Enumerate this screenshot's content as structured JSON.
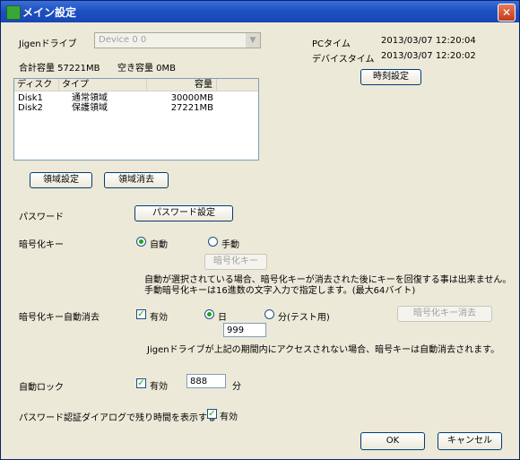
{
  "window": {
    "title": "メイン設定",
    "close": "✕"
  },
  "drive": {
    "label": "Jigenドライブ",
    "selected": "Device 0 0"
  },
  "capacity": {
    "total": "合計容量 57221MB",
    "free": "空き容量 0MB"
  },
  "clock": {
    "pc_label": "PCタイム",
    "pc_value": "2013/03/07 12:20:04",
    "device_label": "デバイスタイム",
    "device_value": "2013/03/07 12:20:02",
    "set_button": "時刻設定"
  },
  "disk_list": {
    "columns": [
      "ディスク",
      "タイプ",
      "容量"
    ],
    "rows": [
      [
        "Disk1",
        "通常領域",
        "30000MB"
      ],
      [
        "Disk2",
        "保護領域",
        "27221MB"
      ]
    ]
  },
  "area_buttons": {
    "setting": "領域設定",
    "erase": "領域消去"
  },
  "password": {
    "label": "パスワード",
    "button": "パスワード設定"
  },
  "enc_key": {
    "label": "暗号化キー",
    "auto": "自動",
    "manual": "手動",
    "button": "暗号化キー",
    "note1": "自動が選択されている場合、暗号化キーが消去された後にキーを回復する事は出来ません。",
    "note2": "手動暗号化キーは16進数の文字入力で指定します。(最大64バイト)"
  },
  "auto_erase": {
    "label": "暗号化キー自動消去",
    "enabled": "有効",
    "day": "日",
    "minute": "分(テスト用)",
    "erase_button": "暗号化キー消去",
    "value": "999",
    "note": "Jigenドライブが上記の期間内にアクセスされない場合、暗号キーは自動消去されます。"
  },
  "auto_lock": {
    "label": "自動ロック",
    "enabled": "有効",
    "value": "888",
    "unit": "分"
  },
  "remaining": {
    "label": "パスワード認証ダイアログで残り時間を表示する",
    "enabled": "有効"
  },
  "footer": {
    "ok": "OK",
    "cancel": "キャンセル"
  }
}
